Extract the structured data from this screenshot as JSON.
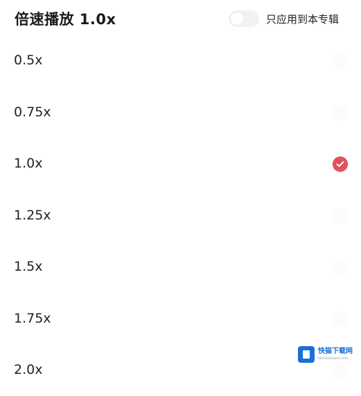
{
  "header": {
    "title": "倍速播放 1.0x",
    "toggle_label": "只应用到本专辑",
    "toggle_on": false
  },
  "options": [
    {
      "label": "0.5x",
      "selected": false
    },
    {
      "label": "0.75x",
      "selected": false
    },
    {
      "label": "1.0x",
      "selected": true
    },
    {
      "label": "1.25x",
      "selected": false
    },
    {
      "label": "1.5x",
      "selected": false
    },
    {
      "label": "1.75x",
      "selected": false
    },
    {
      "label": "2.0x",
      "selected": false
    }
  ],
  "icons": {
    "selected_check": "check-icon",
    "watermark_logo": "site-logo-icon"
  },
  "colors": {
    "accent": "#e0515c",
    "text": "#222222",
    "background": "#ffffff",
    "watermark": "#1a6fd6"
  },
  "watermark": {
    "title": "快猫下载网",
    "url": "kkmaoxiazai.com"
  }
}
